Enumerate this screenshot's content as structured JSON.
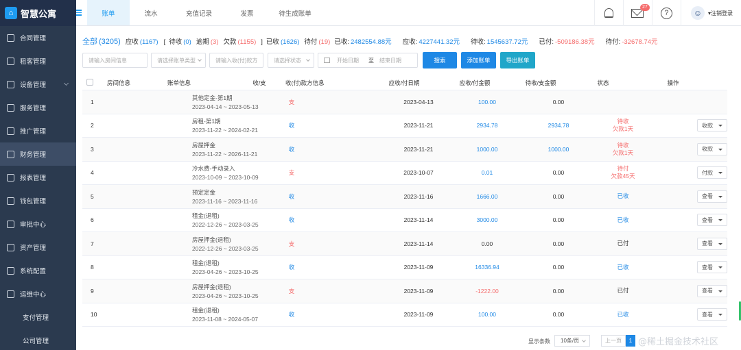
{
  "app": {
    "name": "智慧公寓",
    "logo_icon": "home-icon"
  },
  "sidebar": {
    "items": [
      {
        "label": "合同管理",
        "icon": "contract-icon"
      },
      {
        "label": "租客管理",
        "icon": "tenant-icon"
      },
      {
        "label": "设备管理",
        "icon": "device-icon",
        "expandable": true
      },
      {
        "label": "服务管理",
        "icon": "service-icon"
      },
      {
        "label": "推广管理",
        "icon": "promotion-icon"
      },
      {
        "label": "财务管理",
        "icon": "finance-icon",
        "active": true
      },
      {
        "label": "报表管理",
        "icon": "report-icon"
      },
      {
        "label": "钱包管理",
        "icon": "wallet-icon"
      },
      {
        "label": "审批中心",
        "icon": "approval-icon"
      },
      {
        "label": "资产管理",
        "icon": "asset-icon"
      },
      {
        "label": "系统配置",
        "icon": "settings-icon"
      },
      {
        "label": "运维中心",
        "icon": "ops-icon",
        "expanded": true
      }
    ],
    "subitems": [
      {
        "label": "支付管理"
      },
      {
        "label": "公司管理"
      }
    ]
  },
  "topbar": {
    "tabs": [
      {
        "label": "账单",
        "active": true
      },
      {
        "label": "流水"
      },
      {
        "label": "充值记录"
      },
      {
        "label": "发票"
      },
      {
        "label": "待生成账单"
      }
    ],
    "mail_badge": "27",
    "help_glyph": "?",
    "logout_label": "▾注销登录"
  },
  "stats": {
    "all_label": "全部",
    "all_count": "(3205)",
    "receivable_label": "应收",
    "receivable_count": "(1167)",
    "bracket": "[",
    "pending_label": "待收",
    "pending_count": "(0)",
    "overdue_label": "逾期",
    "overdue_count": "(3)",
    "owed_label": "欠款",
    "owed_count": "(1155)",
    "bracket_close": "]",
    "received_label": "已收",
    "received_count": "(1626)",
    "to_pay_label": "待付",
    "to_pay_count": "(19)",
    "received_amt_label": "已收:",
    "received_amt": "2482554.88元",
    "receivable_amt_label": "应收:",
    "receivable_amt": "4227441.32元",
    "pending_amt_label": "待收:",
    "pending_amt": "1545637.72元",
    "paid_amt_label": "已付:",
    "paid_amt": "-509186.38元",
    "topay_amt_label": "待付:",
    "topay_amt": "-32678.74元"
  },
  "filters": {
    "room_placeholder": "请输入房间信息",
    "bill_type_placeholder": "请选择账单类型",
    "payer_placeholder": "请输入收(付)款方",
    "status_placeholder": "请选择状态",
    "start_date_placeholder": "开始日期",
    "date_separator": "至",
    "end_date_placeholder": "结束日期",
    "search_label": "搜索",
    "add_label": "添加账单",
    "export_label": "导出账单"
  },
  "table": {
    "headers": [
      "房间信息",
      "账单信息",
      "收/支",
      "收(付)款方信息",
      "应收/付日期",
      "应收/付金额",
      "待收/支金额",
      "状态",
      "操作"
    ],
    "rows": [
      {
        "idx": "1",
        "bill": "其他定金-第1期",
        "period": "2023-04-14 ~ 2023-05-13",
        "dir": "支",
        "dir_color": "#f56c6c",
        "date": "2023-04-13",
        "amount": "100.00",
        "amount_color": "#1e88e5",
        "pending": "0.00",
        "pending_color": "#333333",
        "status1": "",
        "status2": "",
        "status_color": "#333333",
        "op": ""
      },
      {
        "idx": "2",
        "bill": "房租-第1期",
        "period": "2023-11-22 ~ 2024-02-21",
        "dir": "收",
        "dir_color": "#1e88e5",
        "date": "2023-11-21",
        "amount": "2934.78",
        "amount_color": "#1e88e5",
        "pending": "2934.78",
        "pending_color": "#1e88e5",
        "status1": "待收",
        "status2": "欠款1天",
        "status_color": "#f56c6c",
        "op": "收款"
      },
      {
        "idx": "3",
        "bill": "房屋押金",
        "period": "2023-11-22 ~ 2026-11-21",
        "dir": "收",
        "dir_color": "#1e88e5",
        "date": "2023-11-21",
        "amount": "1000.00",
        "amount_color": "#1e88e5",
        "pending": "1000.00",
        "pending_color": "#1e88e5",
        "status1": "待收",
        "status2": "欠款1天",
        "status_color": "#f56c6c",
        "op": "收款"
      },
      {
        "idx": "4",
        "bill": "冷水费-手动录入",
        "period": "2023-10-09 ~ 2023-10-09",
        "dir": "支",
        "dir_color": "#f56c6c",
        "date": "2023-10-07",
        "amount": "0.01",
        "amount_color": "#1e88e5",
        "pending": "0.00",
        "pending_color": "#333333",
        "status1": "待付",
        "status2": "欠款45天",
        "status_color": "#f56c6c",
        "op": "付款"
      },
      {
        "idx": "5",
        "bill": "预定定金",
        "period": "2023-11-16 ~ 2023-11-16",
        "dir": "收",
        "dir_color": "#1e88e5",
        "date": "2023-11-16",
        "amount": "1666.00",
        "amount_color": "#1e88e5",
        "pending": "0.00",
        "pending_color": "#333333",
        "status1": "已收",
        "status2": "",
        "status_color": "#1e88e5",
        "op": "查看"
      },
      {
        "idx": "6",
        "bill": "租金(退租)",
        "period": "2022-12-26 ~ 2023-03-25",
        "dir": "收",
        "dir_color": "#1e88e5",
        "date": "2023-11-14",
        "amount": "3000.00",
        "amount_color": "#1e88e5",
        "pending": "0.00",
        "pending_color": "#333333",
        "status1": "已收",
        "status2": "",
        "status_color": "#1e88e5",
        "op": "查看"
      },
      {
        "idx": "7",
        "bill": "房屋押金(退租)",
        "period": "2022-12-26 ~ 2023-03-25",
        "dir": "支",
        "dir_color": "#f56c6c",
        "date": "2023-11-14",
        "amount": "0.00",
        "amount_color": "#333333",
        "pending": "0.00",
        "pending_color": "#333333",
        "status1": "已付",
        "status2": "",
        "status_color": "#333333",
        "op": "查看"
      },
      {
        "idx": "8",
        "bill": "租金(退租)",
        "period": "2023-04-26 ~ 2023-10-25",
        "dir": "收",
        "dir_color": "#1e88e5",
        "date": "2023-11-09",
        "amount": "16336.94",
        "amount_color": "#1e88e5",
        "pending": "0.00",
        "pending_color": "#333333",
        "status1": "已收",
        "status2": "",
        "status_color": "#1e88e5",
        "op": "查看"
      },
      {
        "idx": "9",
        "bill": "房屋押金(退租)",
        "period": "2023-04-26 ~ 2023-10-25",
        "dir": "支",
        "dir_color": "#f56c6c",
        "date": "2023-11-09",
        "amount": "-1222.00",
        "amount_color": "#f56c6c",
        "pending": "0.00",
        "pending_color": "#333333",
        "status1": "已付",
        "status2": "",
        "status_color": "#333333",
        "op": "查看"
      },
      {
        "idx": "10",
        "bill": "租金(退租)",
        "period": "2023-11-08 ~ 2024-05-07",
        "dir": "收",
        "dir_color": "#1e88e5",
        "date": "2023-11-09",
        "amount": "100.00",
        "amount_color": "#1e88e5",
        "pending": "0.00",
        "pending_color": "#333333",
        "status1": "已收",
        "status2": "",
        "status_color": "#1e88e5",
        "op": "查看"
      }
    ]
  },
  "footer": {
    "page_size_label": "显示条数",
    "page_size_value": "10条/页",
    "prev_label": "上一页",
    "current_page": "1"
  },
  "watermark": "@稀土掘金技术社区"
}
